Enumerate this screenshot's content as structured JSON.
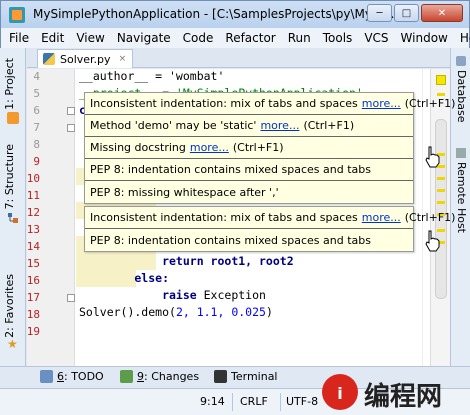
{
  "window": {
    "title": "MySimplePythonApplication - [C:\\SamplesProjects\\py\\MySi...",
    "minimize": "─",
    "maximize": "□",
    "close": "✕"
  },
  "menu": [
    "File",
    "Edit",
    "View",
    "Navigate",
    "Code",
    "Refactor",
    "Run",
    "Tools",
    "VCS",
    "Window",
    "Help"
  ],
  "left_tabs": {
    "project": "1: Project",
    "structure": "7: Structure",
    "favorites": "2: Favorites"
  },
  "right_tabs": {
    "database": "Database",
    "remote_host": "Remote Host"
  },
  "editor_tab": {
    "file": "Solver.py",
    "close": "×"
  },
  "line_numbers": [
    "4",
    "5",
    "6",
    "7",
    "8",
    "9",
    "10",
    "11",
    "12",
    "13",
    "14",
    "15",
    "16",
    "17",
    "18",
    "19"
  ],
  "code": {
    "l4": "__author__ = 'wombat'",
    "l5": "__project__ = 'MySimplePythonApplication'",
    "l6": "c",
    "l14": "            return root1, root2",
    "l15_kw": "        else:",
    "l16_kw": "            raise ",
    "l16_rest": "Exception",
    "l17_a": "Solver().demo(",
    "l17_nums": "2, 1.1, 0.025",
    "l17_b": ")"
  },
  "tooltip1": {
    "rows": [
      {
        "text": "Inconsistent indentation: mix of tabs and spaces",
        "link": "more...",
        "shortcut": "(Ctrl+F1)"
      },
      {
        "text": "Method 'demo' may be 'static'",
        "link": "more...",
        "shortcut": "(Ctrl+F1)"
      },
      {
        "text": "Missing docstring",
        "link": "more...",
        "shortcut": "(Ctrl+F1)"
      },
      {
        "text": "PEP 8: indentation contains mixed spaces and tabs",
        "link": "",
        "shortcut": ""
      },
      {
        "text": "PEP 8: missing whitespace after ','",
        "link": "",
        "shortcut": ""
      }
    ]
  },
  "tooltip2": {
    "rows": [
      {
        "text": "Inconsistent indentation: mix of tabs and spaces",
        "link": "more...",
        "shortcut": "(Ctrl+F1)"
      },
      {
        "text": "PEP 8: indentation contains mixed spaces and tabs",
        "link": "",
        "shortcut": ""
      }
    ]
  },
  "bottom_tabs": {
    "todo_key": "6",
    "todo": ": TODO",
    "changes_key": "9",
    "changes": ": Changes",
    "terminal": "Terminal"
  },
  "status": {
    "position": "9:14",
    "line_sep": "CRLF",
    "encoding": "UTF-8"
  },
  "watermark": "编程网",
  "colors": {
    "warning_bg": "#f7f1c8",
    "tooltip_bg": "#ffffe1",
    "stripe_mark": "#f2d600"
  }
}
